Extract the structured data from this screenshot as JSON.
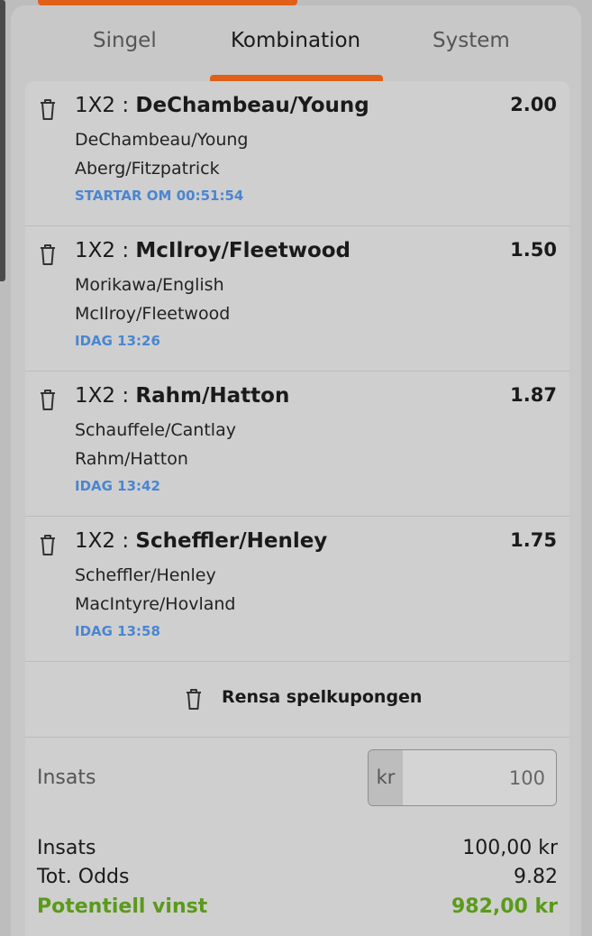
{
  "tabs": [
    {
      "label": "Singel",
      "active": false
    },
    {
      "label": "Kombination",
      "active": true
    },
    {
      "label": "System",
      "active": false
    }
  ],
  "bets": [
    {
      "market": "1X2 :",
      "selection": "DeChambeau/Young",
      "odds": "2.00",
      "team1": "DeChambeau/Young",
      "team2": "Aberg/Fitzpatrick",
      "time": "STARTAR OM 00:51:54"
    },
    {
      "market": "1X2 :",
      "selection": "McIlroy/Fleetwood",
      "odds": "1.50",
      "team1": "Morikawa/English",
      "team2": "McIlroy/Fleetwood",
      "time": "IDAG 13:26"
    },
    {
      "market": "1X2 :",
      "selection": "Rahm/Hatton",
      "odds": "1.87",
      "team1": "Schauffele/Cantlay",
      "team2": "Rahm/Hatton",
      "time": "IDAG 13:42"
    },
    {
      "market": "1X2 :",
      "selection": "Scheffler/Henley",
      "odds": "1.75",
      "team1": "Scheffler/Henley",
      "team2": "MacIntyre/Hovland",
      "time": "IDAG 13:58"
    }
  ],
  "clear": {
    "label": "Rensa spelkupongen"
  },
  "stake": {
    "label": "Insats",
    "currency": "kr",
    "value": "100"
  },
  "summary": {
    "stake_label": "Insats",
    "stake_value": "100,00 kr",
    "odds_label": "Tot. Odds",
    "odds_value": "9.82",
    "win_label": "Potentiell vinst",
    "win_value": "982,00 kr"
  },
  "colors": {
    "accent": "#e0601a",
    "time": "#4a86d0",
    "win": "#5a9a1a"
  },
  "icons": {
    "delete": "trash-icon"
  }
}
